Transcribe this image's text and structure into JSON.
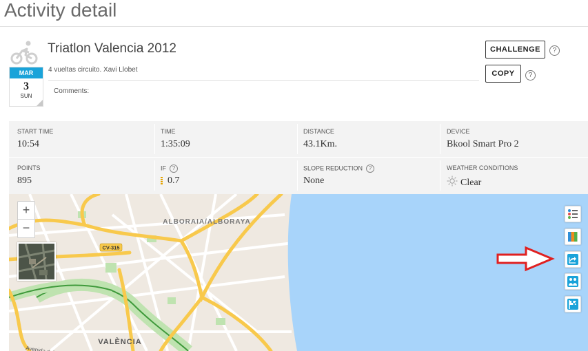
{
  "page": {
    "title": "Activity detail"
  },
  "activity": {
    "title": "Triatlon Valencia 2012",
    "description": "4 vueltas circuito. Xavi Llobet",
    "comments_label": "Comments:",
    "sport_icon": "cycling-icon",
    "date": {
      "month": "MAR",
      "day": "3",
      "weekday": "SUN"
    }
  },
  "actions": {
    "challenge_label": "CHALLENGE",
    "copy_label": "COPY",
    "help_glyph": "?"
  },
  "stats": {
    "start_time": {
      "label": "START TIME",
      "value": "10:54"
    },
    "time": {
      "label": "TIME",
      "value": "1:35:09"
    },
    "distance": {
      "label": "DISTANCE",
      "value": "43.1Km."
    },
    "device": {
      "label": "DEVICE",
      "value": "Bkool Smart Pro 2"
    },
    "points": {
      "label": "POINTS",
      "value": "895"
    },
    "if": {
      "label": "IF",
      "value": "0.7"
    },
    "slope_reduction": {
      "label": "SLOPE REDUCTION",
      "value": "None"
    },
    "weather": {
      "label": "WEATHER CONDITIONS",
      "value": "Clear",
      "icon": "sun-icon"
    }
  },
  "map": {
    "zoom_in": "+",
    "zoom_out": "−",
    "labels": {
      "alboraia": "ALBORAIA/ALBORAYA",
      "valencia": "VALÈNCIA",
      "road": "CV-315",
      "avenue": "Avenida del Cid"
    },
    "colors": {
      "sea": "#a8d4fa",
      "land": "#efe9e1",
      "highway": "#f8c94c",
      "park": "#bfe3b0",
      "river": "#3f9a3b"
    },
    "tools": [
      "legend-icon",
      "colors-icon",
      "share-icon",
      "compare-icon",
      "flag-icon"
    ]
  },
  "annotation": {
    "arrow_color": "#e02020"
  }
}
